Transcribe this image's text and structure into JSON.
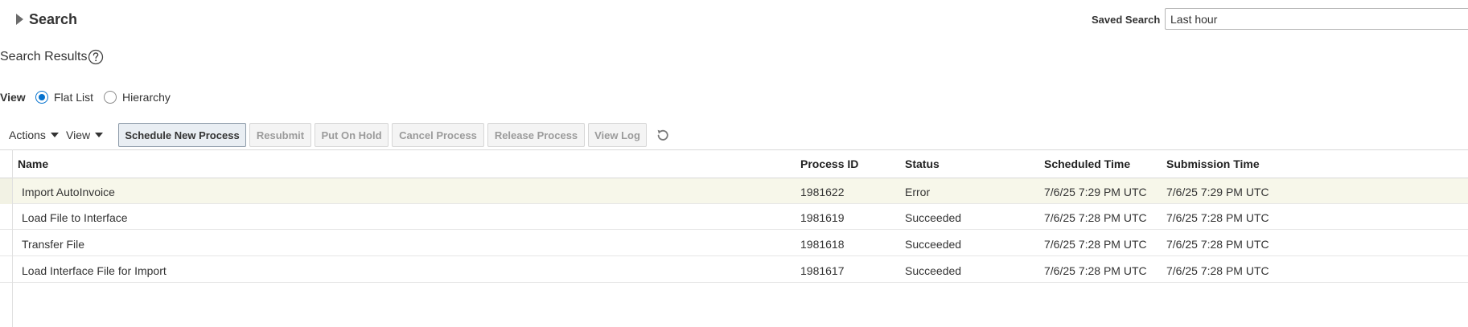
{
  "search": {
    "title": "Search",
    "saved_search_label": "Saved Search",
    "saved_search_value": "Last hour"
  },
  "results": {
    "title": "Search Results",
    "help_icon": "help-icon"
  },
  "view": {
    "label": "View",
    "options": [
      "Flat List",
      "Hierarchy"
    ],
    "selected": "Flat List"
  },
  "toolbar": {
    "actions_label": "Actions",
    "view_label": "View",
    "schedule_label": "Schedule New Process",
    "resubmit_label": "Resubmit",
    "hold_label": "Put On Hold",
    "cancel_label": "Cancel Process",
    "release_label": "Release Process",
    "viewlog_label": "View Log",
    "refresh_icon": "refresh-icon"
  },
  "table": {
    "columns": [
      "Name",
      "Process ID",
      "Status",
      "Scheduled Time",
      "Submission Time"
    ],
    "rows": [
      {
        "name": "Import AutoInvoice",
        "pid": "1981622",
        "status": "Error",
        "scheduled": "7/6/25 7:29 PM UTC",
        "submitted": "7/6/25 7:29 PM UTC",
        "selected": true
      },
      {
        "name": "Load File to Interface",
        "pid": "1981619",
        "status": "Succeeded",
        "scheduled": "7/6/25 7:28 PM UTC",
        "submitted": "7/6/25 7:28 PM UTC",
        "selected": false
      },
      {
        "name": "Transfer File",
        "pid": "1981618",
        "status": "Succeeded",
        "scheduled": "7/6/25 7:28 PM UTC",
        "submitted": "7/6/25 7:28 PM UTC",
        "selected": false
      },
      {
        "name": "Load Interface File for Import",
        "pid": "1981617",
        "status": "Succeeded",
        "scheduled": "7/6/25 7:28 PM UTC",
        "submitted": "7/6/25 7:28 PM UTC",
        "selected": false
      }
    ]
  },
  "colors": {
    "accent": "#0572ce",
    "selected_row": "#f7f7ea"
  }
}
